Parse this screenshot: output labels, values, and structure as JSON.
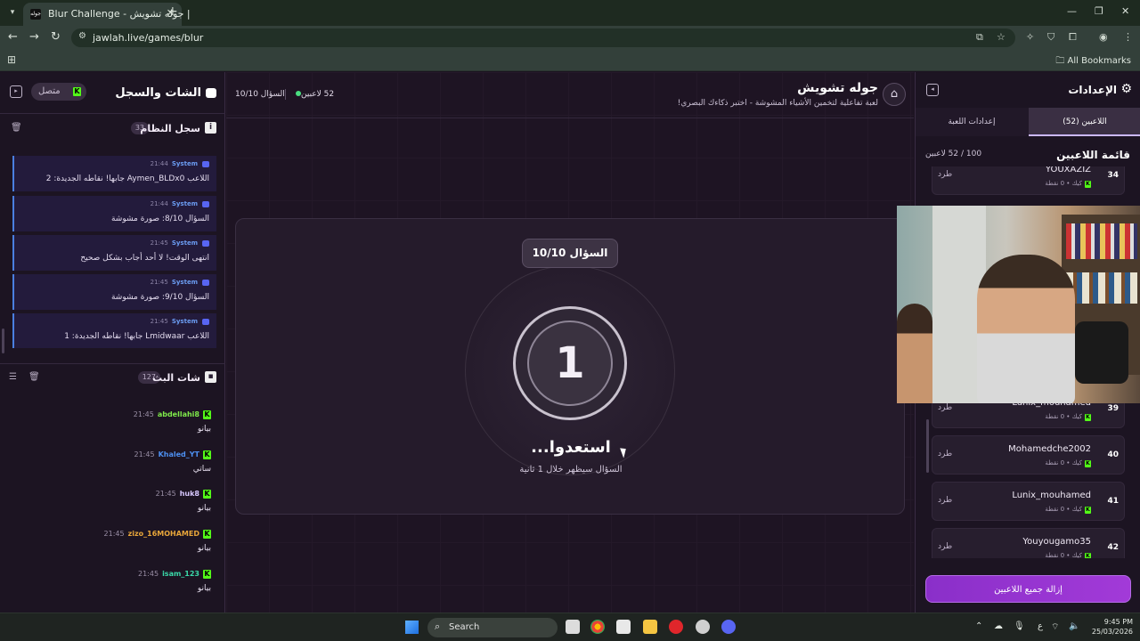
{
  "browser": {
    "tab_title": "Blur Challenge - جوله تشويش |",
    "tab_favicon_text": "جوله",
    "url": "jawlah.live/games/blur",
    "all_bookmarks": "All Bookmarks"
  },
  "chat_panel": {
    "title": "الشات والسجل",
    "status": "متصل",
    "system_log": {
      "title": "سجل النظام",
      "count": "33",
      "messages": [
        {
          "sender": "System",
          "time": "21:44",
          "text": "اللاعب Aymen_BLDx0 جابها! نقاطه الجديدة: 2"
        },
        {
          "sender": "System",
          "time": "21:44",
          "text": "السؤال 8/10: صورة مشوشة"
        },
        {
          "sender": "System",
          "time": "21:45",
          "text": "انتهى الوقت! لا أحد أجاب بشكل صحيح"
        },
        {
          "sender": "System",
          "time": "21:45",
          "text": "السؤال 9/10: صورة مشوشة"
        },
        {
          "sender": "System",
          "time": "21:45",
          "text": "اللاعب Lmidwaar جابها! نقاطه الجديدة: 1"
        }
      ]
    },
    "stream_chat": {
      "title": "شات البث",
      "count": "127",
      "messages": [
        {
          "user": "abdellahi8",
          "time": "21:45",
          "text": "بيانو",
          "color": "#7ee84a"
        },
        {
          "user": "Khaled_YT",
          "time": "21:45",
          "text": "ساتي",
          "color": "#4d8ff0"
        },
        {
          "user": "huk8",
          "time": "21:45",
          "text": "بيانو",
          "color": "#d8c8ff"
        },
        {
          "user": "zizo_16MOHAMED",
          "time": "21:45",
          "text": "بيانو",
          "color": "#e8a63a"
        },
        {
          "user": "isam_123",
          "time": "21:45",
          "text": "بيانو",
          "color": "#3ad8a8"
        }
      ]
    }
  },
  "game": {
    "title": "جوله تشويش",
    "subtitle": "لعبة تفاعلية لتخمين الأشياء المشوشة - اختبر ذكاءك البصري!",
    "players_online": "52 لاعبين",
    "question_progress": "السؤال 10/10",
    "question_badge": "السؤال 10/10",
    "countdown": "1",
    "ready_text": "...استعدوا",
    "ready_sub": "السؤال سيظهر خلال 1 ثانية"
  },
  "settings_panel": {
    "title": "الإعدادات",
    "tabs": [
      {
        "label": "اللاعبين (52)",
        "active": true
      },
      {
        "label": "إعدادات اللعبة",
        "active": false
      }
    ],
    "players_list_title": "قائمة اللاعبين",
    "players_count": "100 / 52 لاعبين",
    "kick_label": "طرد",
    "player_sub": "كيك • 0 نقطة",
    "players": [
      {
        "rank": "34",
        "name": "YOUXAZIZ"
      },
      {
        "rank": "39",
        "name": "Lunix_mouhamed"
      },
      {
        "rank": "40",
        "name": "Mohamedche2002"
      },
      {
        "rank": "41",
        "name": "Lunix_mouhamed"
      },
      {
        "rank": "42",
        "name": "Youyougamo35"
      }
    ],
    "clear_button": "إزالة جميع اللاعبين"
  },
  "taskbar": {
    "search_label": "Search",
    "language": "ع",
    "time": "9:45 PM",
    "date": "25/03/2026"
  },
  "colors": {
    "accent": "#a23ad8",
    "kick_green": "#53fc18",
    "online_dot": "#4ade80",
    "system_blue": "#4a7fe0"
  }
}
